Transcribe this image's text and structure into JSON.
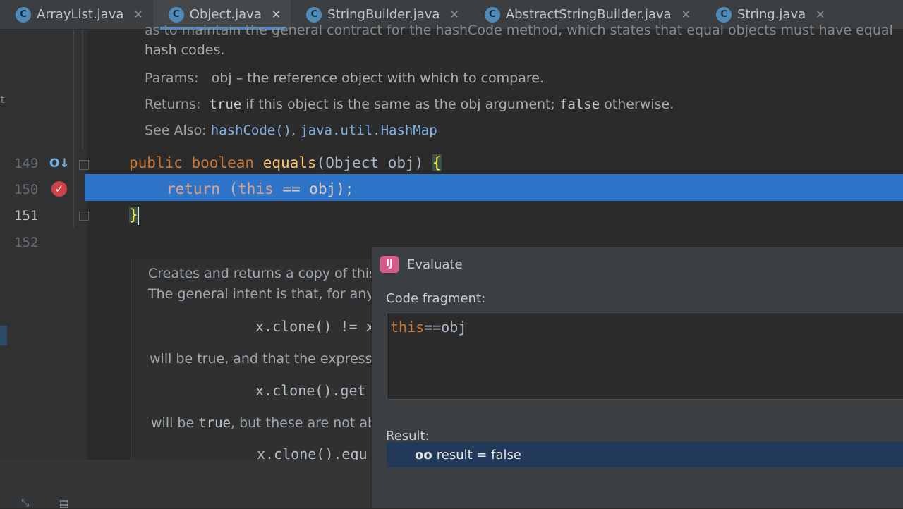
{
  "tabs": [
    {
      "label": "ArrayList.java",
      "active": false
    },
    {
      "label": "Object.java",
      "active": true
    },
    {
      "label": "StringBuilder.java",
      "active": false
    },
    {
      "label": "AbstractStringBuilder.java",
      "active": false
    },
    {
      "label": "String.java",
      "active": false
    }
  ],
  "tab_close_glyph": "✕",
  "tab_icon_letter": "C",
  "doc": {
    "line0": "as to maintain the general contract for the hashCode method, which states that equal objects must have equal",
    "line1": "hash codes.",
    "params_label": "Params:",
    "params_text": "obj – the reference object with which to compare.",
    "returns_label": "Returns:",
    "returns_true": "true",
    "returns_mid": " if this object is the same as the obj argument; ",
    "returns_false": "false",
    "returns_end": " otherwise.",
    "see_label": "See Also:",
    "see_link1": "hashCode()",
    "see_sep": ", ",
    "see_link2": "java.util.HashMap"
  },
  "line_numbers": [
    "149",
    "150",
    "151",
    "152"
  ],
  "code": {
    "l149_kw1": "public",
    "l149_kw2": "boolean",
    "l149_fn": "equals",
    "l149_rest": "(Object obj) ",
    "l149_brace": "{",
    "l150_kw": "return",
    "l150_mid": " (",
    "l150_this": "this",
    "l150_rest": " == obj);",
    "l151": "}"
  },
  "lower_doc": {
    "line1": "Creates and returns a copy of this o",
    "line2": "The general intent is that, for any o",
    "code1": "x.clone() != x",
    "line3": "will be true, and that the expressio",
    "code2": "x.clone().get",
    "line4_a": "will be ",
    "line4_true": "true",
    "line4_b": ", but these are not abs",
    "code3": "x.clone().equ"
  },
  "dialog": {
    "icon_text": "IJ",
    "title": "Evaluate",
    "code_fragment_label": "Code fragment:",
    "expression_this": "this",
    "expression_rest": "==obj",
    "result_label": "Result:",
    "result_text": "result = false",
    "result_icon": "oo"
  }
}
